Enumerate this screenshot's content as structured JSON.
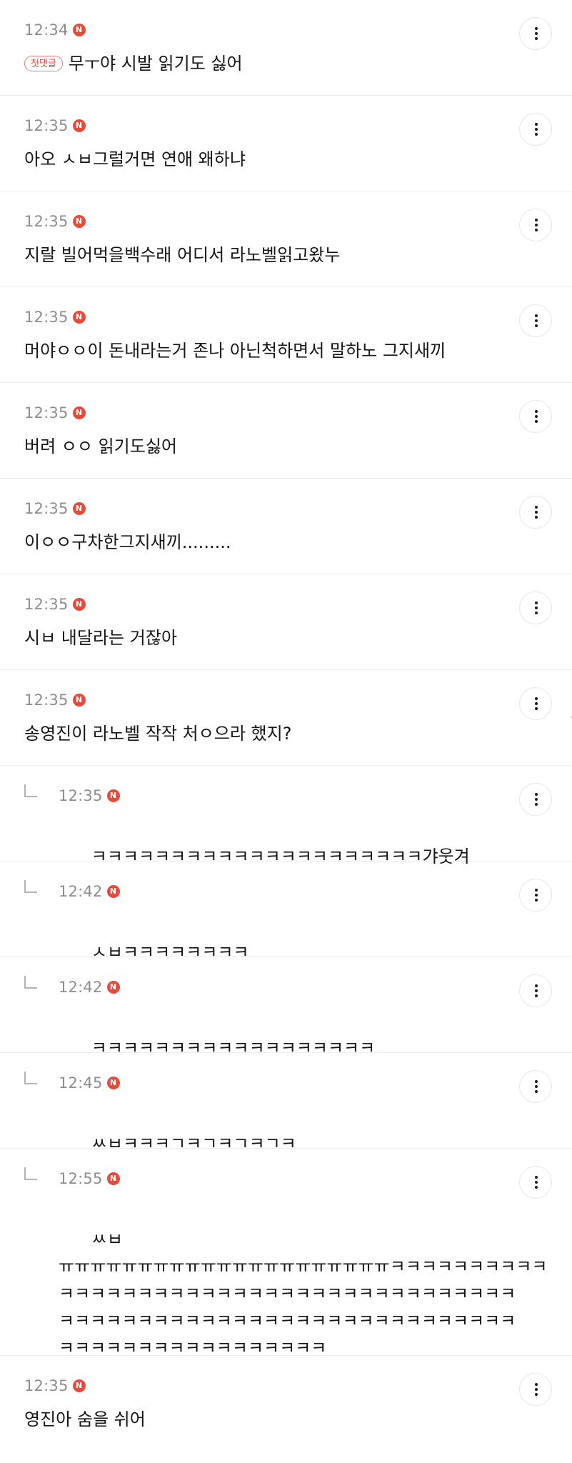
{
  "comments": [
    {
      "time": "12:34",
      "new_badge": "N",
      "first_comment_label": "첫댓글",
      "text": "무ㅜ야 시발 읽기도 싫어"
    },
    {
      "time": "12:35",
      "new_badge": "N",
      "text": "아오 ㅅㅂ그럴거면 연애 왜하냐"
    },
    {
      "time": "12:35",
      "new_badge": "N",
      "text": "지랄 빌어먹을백수래 어디서 라노벨읽고왔누"
    },
    {
      "time": "12:35",
      "new_badge": "N",
      "text": "머야ㅇㅇ이 돈내라는거 존나 아닌척하면서 말하노 그지새끼"
    },
    {
      "time": "12:35",
      "new_badge": "N",
      "text": "버려 ㅇㅇ 읽기도싫어"
    },
    {
      "time": "12:35",
      "new_badge": "N",
      "text": "이ㅇㅇ구차한그지새끼........."
    },
    {
      "time": "12:35",
      "new_badge": "N",
      "text": "시ㅂ 내달라는 거잖아"
    },
    {
      "time": "12:35",
      "new_badge": "N",
      "text": "송영진이 라노벨 작작 처ㅇ으라 했지?"
    }
  ],
  "replies": [
    {
      "time": "12:35",
      "new_badge": "N",
      "text": "ㅋㅋㅋㅋㅋㅋㅋㅋㅋㅋㅋㅋㅋㅋㅋㅋㅋㅋㅋㅋㅋ갸웃겨"
    },
    {
      "time": "12:42",
      "new_badge": "N",
      "text": "ㅅㅂㅋㅋㅋㅋㅋㅋㅋㅋ"
    },
    {
      "time": "12:42",
      "new_badge": "N",
      "text": "ㅋㅋㅋㅋㅋㅋㅋㅋㅋㅋㅋㅋㅋㅋㅋㅋㅋㅋ"
    },
    {
      "time": "12:45",
      "new_badge": "N",
      "text": "ㅆㅂㅋㅋㅋㄱㅋㄱㅋㄱㅋㄱㅋ"
    },
    {
      "time": "12:55",
      "new_badge": "N",
      "text": "ㅆㅂ\nㅠㅠㅠㅠㅠㅠㅠㅠㅠㅠㅠㅠㅠㅠㅠㅠㅠㅠㅠㅠㅠㅋㅋㅋㅋㅋㅋㅋㅋㅋㅋ\nㅋㅋㅋㅋㅋㅋㅋㅋㅋㅋㅋㅋㅋㅋㅋㅋㅋㅋㅋㅋㅋㅋㅋㅋㅋㅋㅋㅋㅋ\nㅋㅋㅋㅋㅋㅋㅋㅋㅋㅋㅋㅋㅋㅋㅋㅋㅋㅋㅋㅋㅋㅋㅋㅋㅋㅋㅋㅋㅋ\nㅋㅋㅋㅋㅋㅋㅋㅋㅋㅋㅋㅋㅋㅋㅋㅋㅋ"
    }
  ],
  "final_comment": {
    "time": "12:35",
    "new_badge": "N",
    "text": "영진아 숨을 쉬어"
  },
  "icons": {
    "more": "more-vertical-icon",
    "reply": "reply-arrow-icon",
    "new": "new-badge-icon"
  },
  "colors": {
    "new_badge": "#e64a3b",
    "first_comment_badge": "#e0443c",
    "timestamp": "#8e8e8e",
    "divider": "#ededed"
  }
}
